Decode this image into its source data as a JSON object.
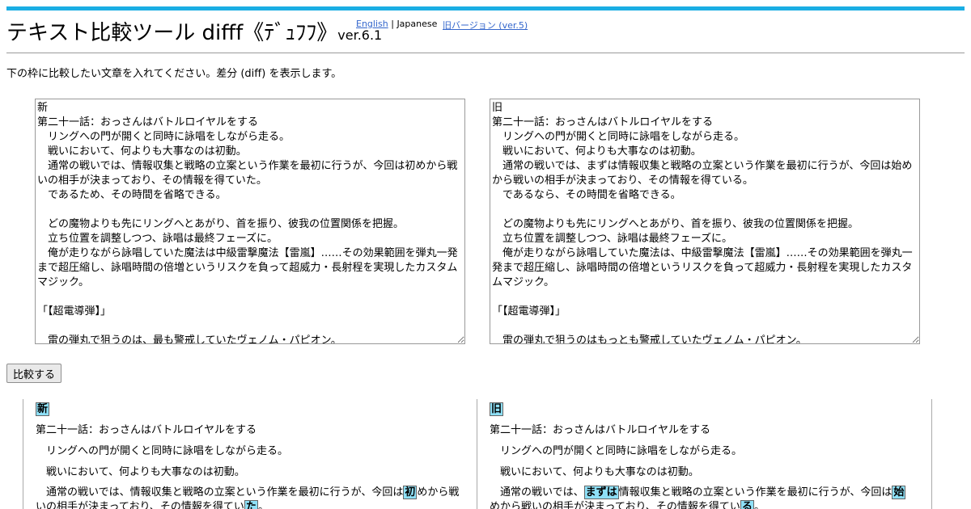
{
  "header": {
    "title": "テキスト比較ツール difff《ﾃﾞｭﾌﾌ》",
    "version": "ver.6.1",
    "lang_english": "English",
    "lang_separator": " | ",
    "lang_japanese": "Japanese",
    "old_version": "旧バージョン (ver.5)",
    "accent_color": "#1aaee4"
  },
  "description": "下の枠に比較したい文章を入れてください。差分 (diff) を表示します。",
  "input": {
    "new_text": "新\n第二十一話：おっさんはバトルロイヤルをする\n　リングへの門が開くと同時に詠唱をしながら走る。\n　戦いにおいて、何よりも大事なのは初動。\n　通常の戦いでは、情報収集と戦略の立案という作業を最初に行うが、今回は初めから戦いの相手が決まっており、その情報を得ていた。\n　であるため、その時間を省略できる。\n\n　どの魔物よりも先にリングへとあがり、首を振り、彼我の位置関係を把握。\n　立ち位置を調整しつつ、詠唱は最終フェーズに。\n　俺が走りながら詠唱していた魔法は中級雷撃魔法【雷嵐】……その効果範囲を弾丸一発まで超圧縮し、詠唱時間の倍増というリスクを負って超威力・長射程を実現したカスタムマジック。\n\n「【超電導弾】」\n\n　雷の弾丸で狙うのは、最も警戒していたヴェノム・パピオン。",
    "old_text": "旧\n第二十一話：おっさんはバトルロイヤルをする\n　リングへの門が開くと同時に詠唱をしながら走る。\n　戦いにおいて、何よりも大事なのは初動。\n　通常の戦いでは、まずは情報収集と戦略の立案という作業を最初に行うが、今回は始めから戦いの相手が決まっており、その情報を得ている。\n　であるなら、その時間を省略できる。\n\n　どの魔物よりも先にリングへとあがり、首を振り、彼我の位置関係を把握。\n　立ち位置を調整しつつ、詠唱は最終フェーズに。\n　俺が走りながら詠唱していた魔法は、中級雷撃魔法【雷嵐】……その効果範囲を弾丸一発まで超圧縮し、詠唱時間の倍増というリスクを負って超威力・長射程を実現したカスタムマジック。\n\n「【超電導弾】」\n\n　雷の弾丸で狙うのはもっとも警戒していたヴェノム・パピオン。"
  },
  "compare_label": "比較する",
  "result": {
    "new": {
      "label": "新",
      "line1": "第二十一話：おっさんはバトルロイヤルをする",
      "line2": "　リングへの門が開くと同時に詠唱をしながら走る。",
      "line3": "　戦いにおいて、何よりも大事なのは初動。",
      "line4_a": "　通常の戦いでは、情報収集と戦略の立案という作業を最初に行うが、今回は",
      "line4_hl1": "初",
      "line4_b": "めから戦いの相手が決まっており、その情報を得てい",
      "line4_hl2": "た",
      "line4_c": "。"
    },
    "old": {
      "label": "旧",
      "line1": "第二十一話：おっさんはバトルロイヤルをする",
      "line2": "　リングへの門が開くと同時に詠唱をしながら走る。",
      "line3": "　戦いにおいて、何よりも大事なのは初動。",
      "line4_a": "　通常の戦いでは、",
      "line4_hl1": "まずは",
      "line4_b": "情報収集と戦略の立案という作業を最初に行うが、今回は",
      "line4_hl2": "始",
      "line4_c": "めから戦いの相手が決まっており、その情報を得てい",
      "line4_hl3": "る",
      "line4_d": "。"
    }
  }
}
